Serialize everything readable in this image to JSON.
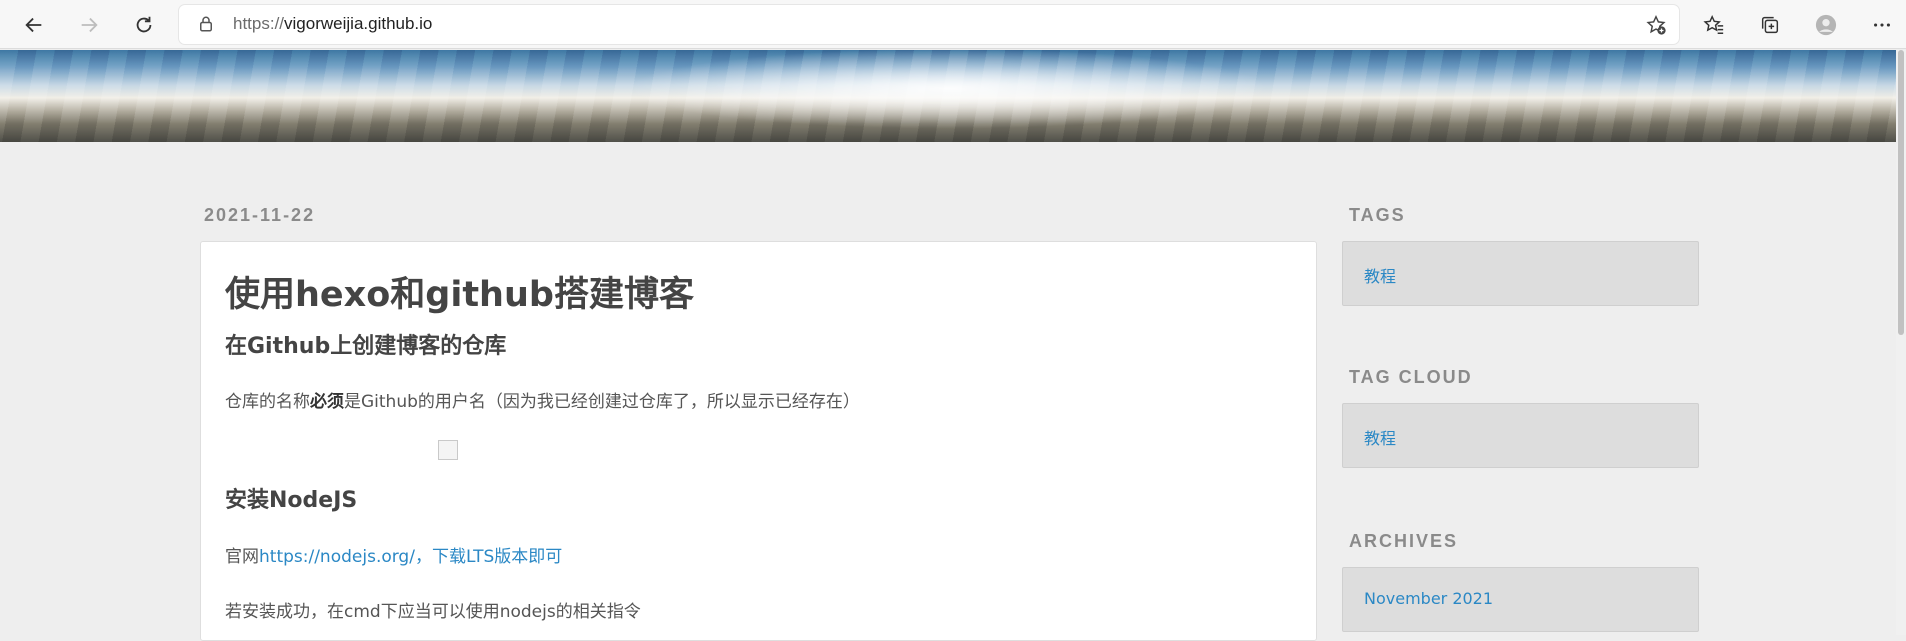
{
  "browser": {
    "url_protocol": "https://",
    "url_host": "vigorweijia.github.io"
  },
  "post": {
    "date": "2021-11-22",
    "title": "使用hexo和github搭建博客",
    "section1_heading": "在Github上创建博客的仓库",
    "section1_text_before": "仓库的名称",
    "section1_text_bold": "必须",
    "section1_text_after": "是Github的用户名（因为我已经创建过仓库了，所以显示已经存在）",
    "section2_heading": "安装NodeJS",
    "section2_text_prefix": "官网",
    "section2_link": "https://nodejs.org/，下载LTS版本即可",
    "section2_text2": "若安装成功，在cmd下应当可以使用nodejs的相关指令"
  },
  "sidebar": {
    "tags_title": "TAGS",
    "tags_item": "教程",
    "tagcloud_title": "TAG CLOUD",
    "tagcloud_item": "教程",
    "archives_title": "ARCHIVES",
    "archives_item": "November 2021"
  },
  "icons": [
    "back-icon",
    "forward-icon",
    "refresh-icon",
    "lock-icon",
    "add-favorite-icon",
    "favorites-icon",
    "collections-icon",
    "profile-icon",
    "more-icon"
  ]
}
